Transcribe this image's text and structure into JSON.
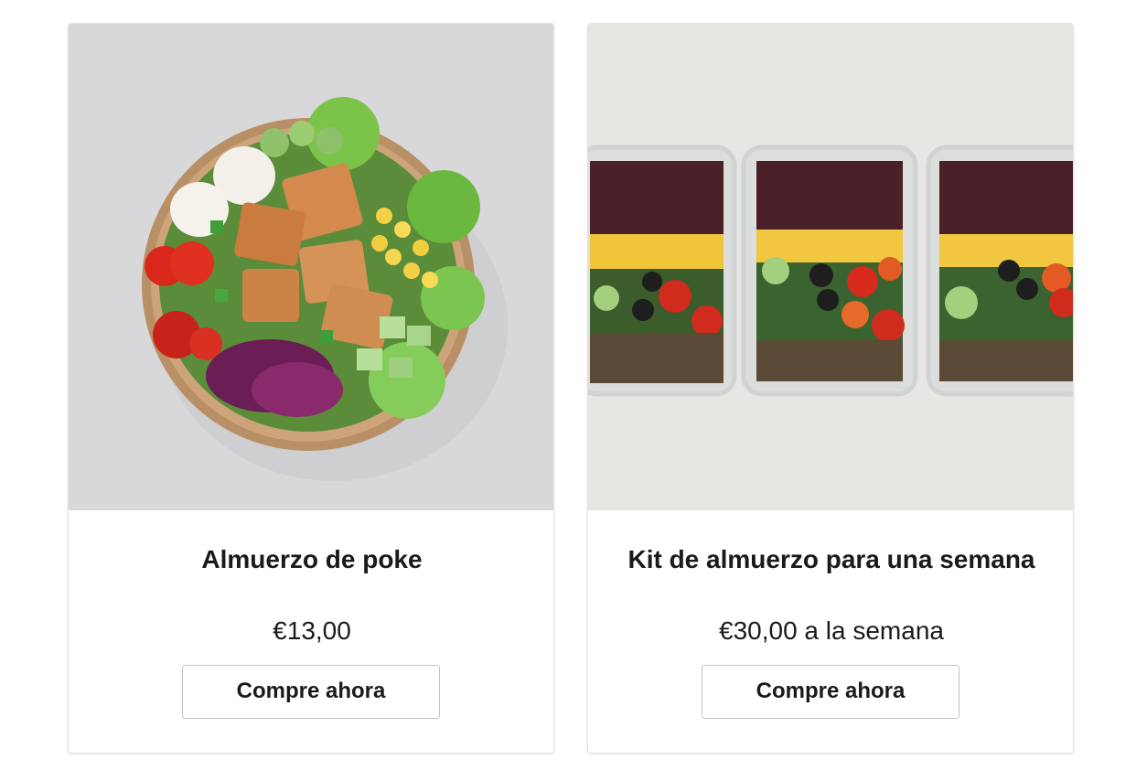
{
  "products": [
    {
      "title": "Almuerzo de poke",
      "price": "€13,00",
      "button_label": "Compre ahora",
      "image": "poke-bowl-photo"
    },
    {
      "title": "Kit de almuerzo para una semana",
      "price": "€30,00 a la semana",
      "button_label": "Compre ahora",
      "image": "meal-prep-containers-photo"
    }
  ],
  "colors": {
    "card_border": "#e3e3e3",
    "button_border": "#c4c4c4",
    "text": "#1a1a1a",
    "photo1_background": "#d9d9db",
    "photo2_background": "#e6e6e4"
  }
}
